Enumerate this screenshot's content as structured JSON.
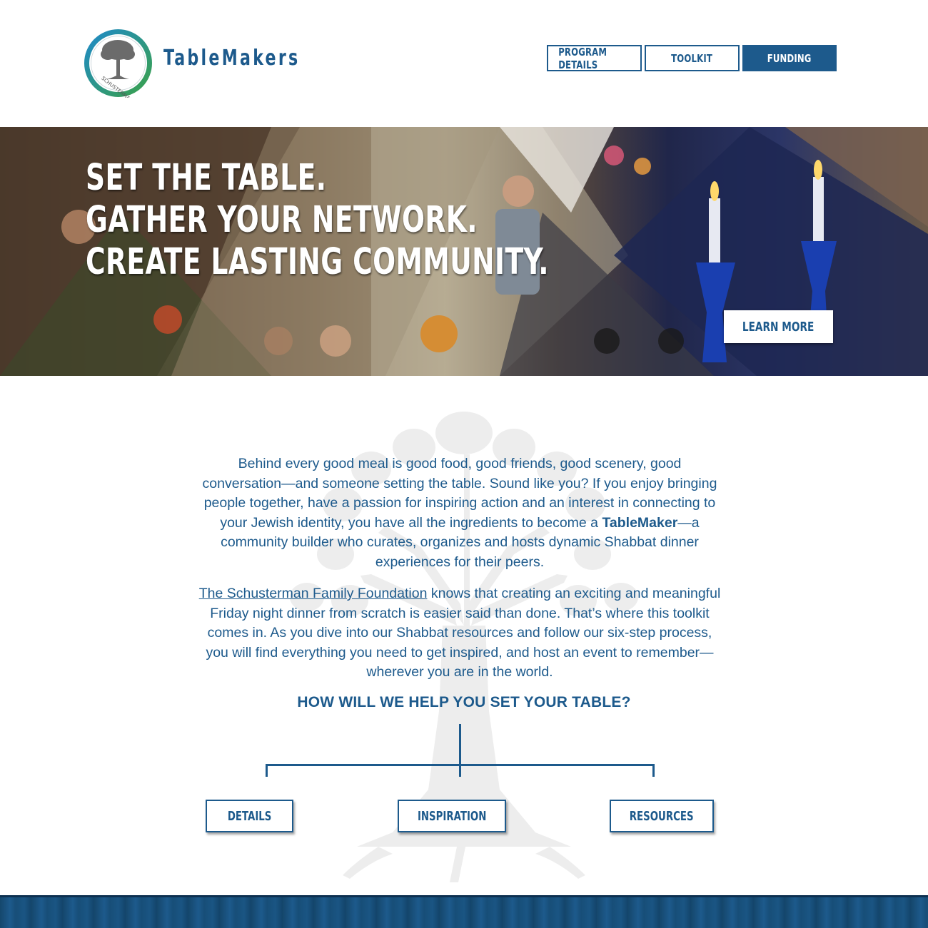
{
  "header": {
    "brand_name": "TableMakers",
    "logo_ring_text": "SCHUSTERMAN",
    "nav": [
      {
        "label": "PROGRAM DETAILS"
      },
      {
        "label": "TOOLKIT"
      },
      {
        "label": "FUNDING"
      }
    ]
  },
  "hero": {
    "lines": [
      "SET THE TABLE.",
      "GATHER YOUR NETWORK.",
      "CREATE LASTING COMMUNITY."
    ],
    "cta_label": "LEARN MORE"
  },
  "intro": {
    "p1_before": "Behind every good meal is good food, good friends, good scenery, good conversation—and someone setting the table. Sound like you? If you enjoy bringing people together, have a passion for inspiring action and an interest in connecting to your Jewish identity, you have all the ingredients to become a ",
    "p1_bold": "TableMaker",
    "p1_after": "—a community builder who curates, organizes and hosts dynamic Shabbat dinner experiences for their peers.",
    "p2_link": "The Schusterman Family Foundation",
    "p2_after": " knows that creating an exciting and meaningful Friday night dinner from scratch is easier said than done. That’s where this toolkit comes in. As you dive into our Shabbat resources and follow our six-step process, you will find everything you need to get inspired, and host an event to remember—wherever you are in the world."
  },
  "help": {
    "heading": "HOW WILL WE HELP YOU SET YOUR TABLE?",
    "buttons": [
      {
        "label": "DETAILS"
      },
      {
        "label": "INSPIRATION"
      },
      {
        "label": "RESOURCES"
      }
    ]
  },
  "colors": {
    "brand_blue": "#1d5a8c",
    "logo_green": "#3aa14a",
    "logo_blue": "#1f8ac8"
  }
}
